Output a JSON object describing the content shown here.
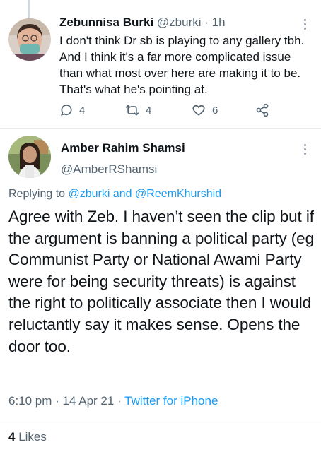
{
  "reply_tweet": {
    "author_name": "Zebunnisa Burki",
    "author_handle": "@zburki",
    "separator": "·",
    "time": "1h",
    "body": "I don't think Dr sb is playing to any gallery tbh. And I think it's a far more complicated issue than what most over here are making it to be. That's what he's pointing at.",
    "replies_count": "4",
    "retweets_count": "4",
    "likes_count": "6",
    "icons": [
      "reply-icon",
      "retweet-icon",
      "like-icon",
      "share-icon",
      "more-options-icon"
    ]
  },
  "main_tweet": {
    "author_name": "Amber Rahim Shamsi",
    "author_handle": "@AmberRShamsi",
    "replying_prefix": "Replying to",
    "replying_user1": "@zburki",
    "replying_and": "and",
    "replying_user2": "@ReemKhurshid",
    "body": "Agree with Zeb. I haven’t seen the clip but if the argument is banning a political party (eg Communist Party or National Awami Party were for being security threats) is against the right to politically associate then I would reluctantly say it makes sense. Opens the door too.",
    "timestamp": "6:10 pm · 14 Apr 21 ·",
    "source": "Twitter for iPhone",
    "likes_count": "4",
    "likes_label": "Likes"
  },
  "colors": {
    "text": "#0f1419",
    "secondary": "#536471",
    "link": "#1d9bf0",
    "divider": "#e6ecf0"
  }
}
